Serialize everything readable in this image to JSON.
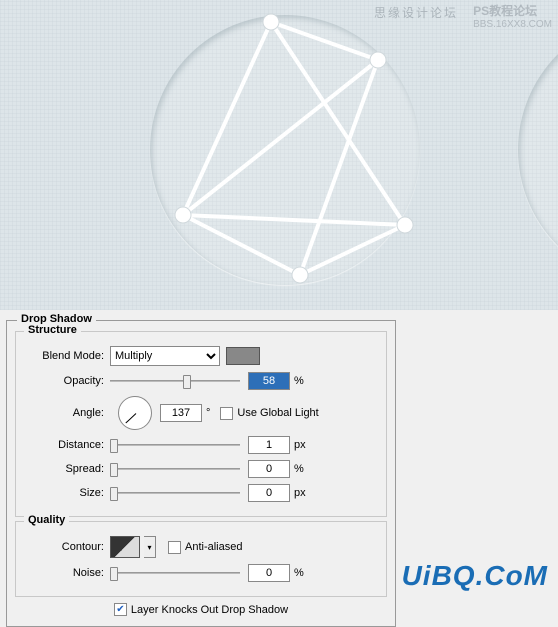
{
  "watermarks": {
    "text1": "思缘设计论坛",
    "text2a": "PS教程论坛",
    "text2b": "BBS.16XX8.COM"
  },
  "panel": {
    "title": "Drop Shadow",
    "structure": {
      "legend": "Structure",
      "blend_mode_label": "Blend Mode:",
      "blend_mode_value": "Multiply",
      "opacity_label": "Opacity:",
      "opacity_value": "58",
      "opacity_unit": "%",
      "angle_label": "Angle:",
      "angle_value": "137",
      "angle_unit": "°",
      "global_light_label": "Use Global Light",
      "global_light_checked": false,
      "distance_label": "Distance:",
      "distance_value": "1",
      "distance_unit": "px",
      "spread_label": "Spread:",
      "spread_value": "0",
      "spread_unit": "%",
      "size_label": "Size:",
      "size_value": "0",
      "size_unit": "px"
    },
    "quality": {
      "legend": "Quality",
      "contour_label": "Contour:",
      "anti_aliased_label": "Anti-aliased",
      "anti_aliased_checked": false,
      "noise_label": "Noise:",
      "noise_value": "0",
      "noise_unit": "%"
    },
    "knockout_label": "Layer Knocks Out Drop Shadow",
    "knockout_checked": true
  },
  "logo": "UiBQ.CoM"
}
